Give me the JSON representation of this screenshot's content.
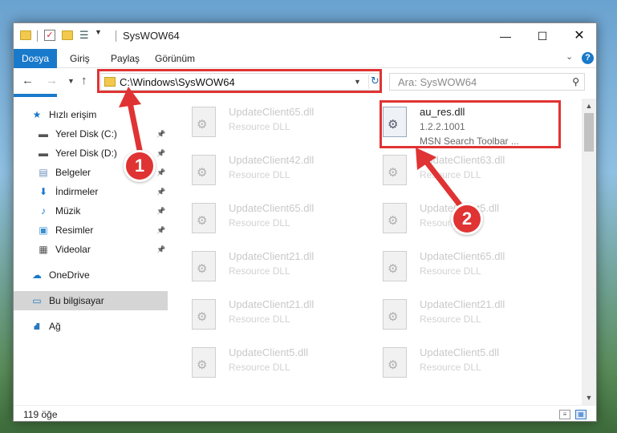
{
  "window": {
    "title": "SysWOW64",
    "controls": {
      "minimize": "—",
      "maximize": "☐",
      "close": "✕"
    }
  },
  "quick_access_toolbar": {
    "icons": [
      "folder-icon",
      "check-icon",
      "new-folder-icon",
      "properties-icon",
      "chevron-down-icon"
    ]
  },
  "ribbon": {
    "tabs": [
      "Dosya",
      "Giriş",
      "Paylaş",
      "Görünüm"
    ],
    "help_label": "?",
    "expand_label": "⌄"
  },
  "nav": {
    "back": "←",
    "forward": "→",
    "recent": "⌄",
    "up": "↑",
    "address": "C:\\Windows\\SysWOW64",
    "address_dropdown": "⌄",
    "refresh": "↻",
    "search_placeholder": "Ara: SysWOW64"
  },
  "sidebar": {
    "items": [
      {
        "label": "Hızlı erişim",
        "icon": "star-icon",
        "glyph": "★",
        "color": "#1979ca",
        "pinned": false
      },
      {
        "label": "Yerel Disk (C:)",
        "icon": "drive-icon",
        "glyph": "▬",
        "color": "#555555",
        "pinned": true
      },
      {
        "label": "Yerel Disk (D:)",
        "icon": "drive-icon",
        "glyph": "▬",
        "color": "#555555",
        "pinned": true
      },
      {
        "label": "Belgeler",
        "icon": "document-icon",
        "glyph": "▤",
        "color": "#6b8fb8",
        "pinned": true
      },
      {
        "label": "İndirmeler",
        "icon": "download-icon",
        "glyph": "⬇",
        "color": "#1979ca",
        "pinned": true
      },
      {
        "label": "Müzik",
        "icon": "music-icon",
        "glyph": "♪",
        "color": "#1979ca",
        "pinned": true
      },
      {
        "label": "Resimler",
        "icon": "pictures-icon",
        "glyph": "▣",
        "color": "#3a8fd1",
        "pinned": true
      },
      {
        "label": "Videolar",
        "icon": "video-icon",
        "glyph": "▦",
        "color": "#555555",
        "pinned": true
      },
      {
        "label": "OneDrive",
        "icon": "cloud-icon",
        "glyph": "☁",
        "color": "#1979ca",
        "pinned": false
      },
      {
        "label": "Bu bilgisayar",
        "icon": "computer-icon",
        "glyph": "▭",
        "color": "#2a7abf",
        "pinned": false,
        "selected": true
      },
      {
        "label": "Ağ",
        "icon": "network-icon",
        "glyph": "⛘",
        "color": "#2a7abf",
        "pinned": false
      }
    ]
  },
  "files": {
    "left_column": [
      {
        "name": "UpdateClient65.dll",
        "desc": "Resource DLL"
      },
      {
        "name": "UpdateClient42.dll",
        "desc": "Resource DLL"
      },
      {
        "name": "UpdateClient65.dll",
        "desc": "Resource DLL"
      },
      {
        "name": "UpdateClient21.dll",
        "desc": "Resource DLL"
      },
      {
        "name": "UpdateClient21.dll",
        "desc": "Resource DLL"
      },
      {
        "name": "UpdateClient5.dll",
        "desc": "Resource DLL"
      }
    ],
    "right_column": [
      {
        "name": "au_res.dll",
        "version": "1.2.2.1001",
        "desc": "MSN Search Toolbar ...",
        "highlighted": true
      },
      {
        "name": "UpdateClient63.dll",
        "desc": "Resource DLL"
      },
      {
        "name": "UpdateClient5.dll",
        "desc": "Resource DLL"
      },
      {
        "name": "UpdateClient65.dll",
        "desc": "Resource DLL"
      },
      {
        "name": "UpdateClient21.dll",
        "desc": "Resource DLL"
      },
      {
        "name": "UpdateClient5.dll",
        "desc": "Resource DLL"
      }
    ]
  },
  "status": {
    "count": "119 öğe"
  },
  "annotations": {
    "badge1": "1",
    "badge2": "2",
    "color": "#e03333"
  }
}
